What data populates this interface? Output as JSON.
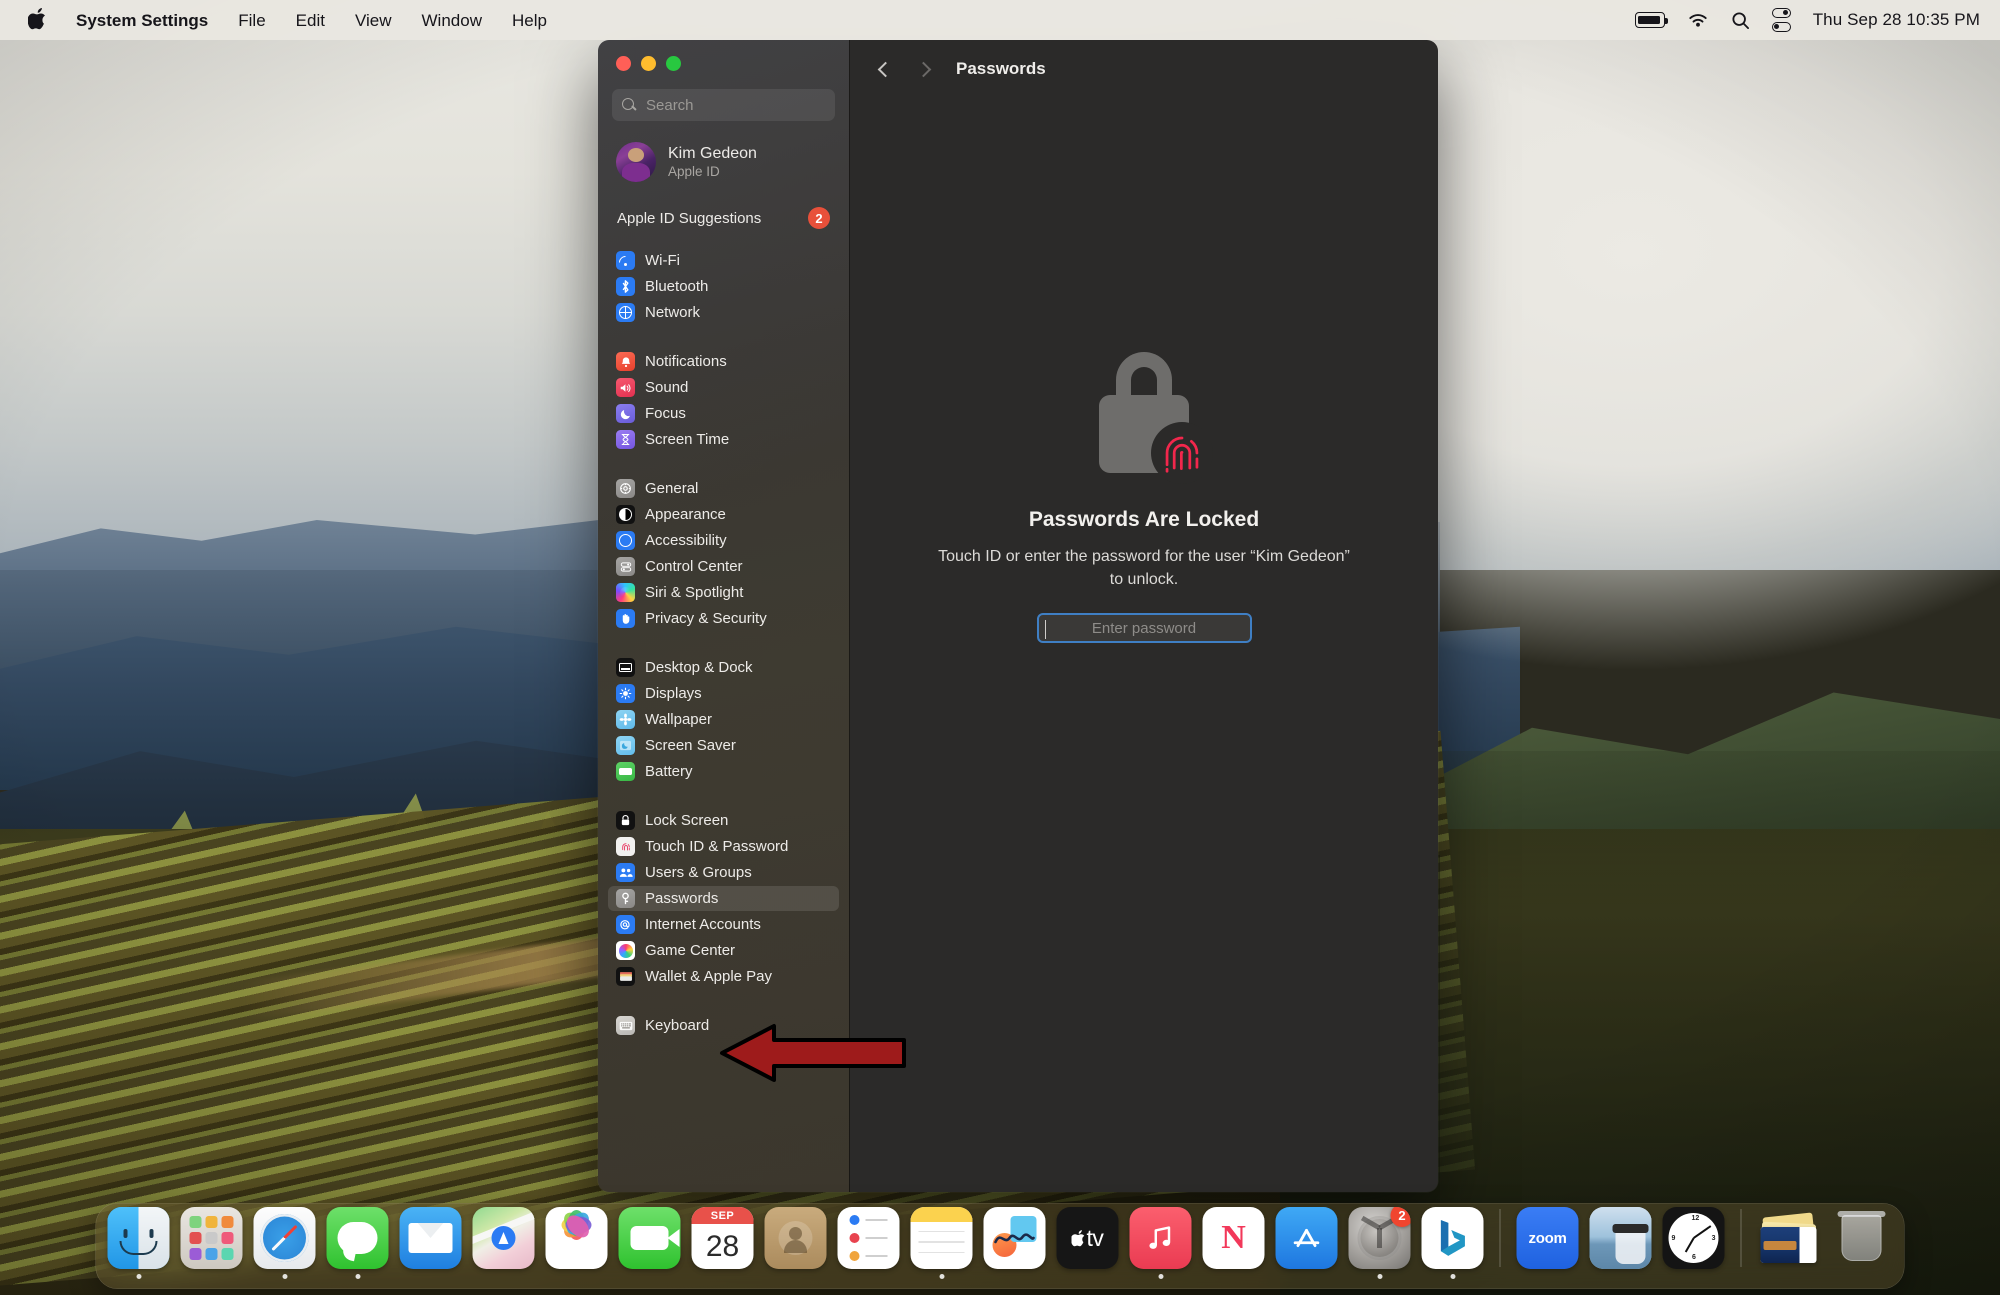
{
  "menubar": {
    "apple_logo": "apple-logo",
    "items": [
      "System Settings",
      "File",
      "Edit",
      "View",
      "Window",
      "Help"
    ],
    "status_icons": [
      "battery-icon",
      "wifi-icon",
      "search-icon",
      "control-center-icon"
    ],
    "clock": "Thu Sep 28  10:35 PM"
  },
  "window": {
    "traffic_lights": [
      "close",
      "minimize",
      "maximize"
    ],
    "search": {
      "placeholder": "Search",
      "value": ""
    },
    "account": {
      "name": "Kim Gedeon",
      "subtitle": "Apple ID"
    },
    "suggestions": {
      "label": "Apple ID Suggestions",
      "badge": "2"
    },
    "sidebar_groups": [
      {
        "items": [
          {
            "label": "Wi-Fi",
            "icon": "wifi-icon"
          },
          {
            "label": "Bluetooth",
            "icon": "bluetooth-icon"
          },
          {
            "label": "Network",
            "icon": "network-globe-icon"
          }
        ]
      },
      {
        "items": [
          {
            "label": "Notifications",
            "icon": "notifications-bell-icon"
          },
          {
            "label": "Sound",
            "icon": "sound-speaker-icon"
          },
          {
            "label": "Focus",
            "icon": "focus-moon-icon"
          },
          {
            "label": "Screen Time",
            "icon": "screen-time-hourglass-icon"
          }
        ]
      },
      {
        "items": [
          {
            "label": "General",
            "icon": "general-gear-icon"
          },
          {
            "label": "Appearance",
            "icon": "appearance-contrast-icon"
          },
          {
            "label": "Accessibility",
            "icon": "accessibility-icon"
          },
          {
            "label": "Control Center",
            "icon": "control-center-icon"
          },
          {
            "label": "Siri & Spotlight",
            "icon": "siri-icon"
          },
          {
            "label": "Privacy & Security",
            "icon": "privacy-hand-icon"
          }
        ]
      },
      {
        "items": [
          {
            "label": "Desktop & Dock",
            "icon": "desktop-dock-icon"
          },
          {
            "label": "Displays",
            "icon": "displays-brightness-icon"
          },
          {
            "label": "Wallpaper",
            "icon": "wallpaper-icon"
          },
          {
            "label": "Screen Saver",
            "icon": "screen-saver-icon"
          },
          {
            "label": "Battery",
            "icon": "battery-icon"
          }
        ]
      },
      {
        "items": [
          {
            "label": "Lock Screen",
            "icon": "lock-screen-icon"
          },
          {
            "label": "Touch ID & Password",
            "icon": "touch-id-icon"
          },
          {
            "label": "Users & Groups",
            "icon": "users-groups-icon"
          },
          {
            "label": "Passwords",
            "icon": "passwords-key-icon",
            "selected": true
          },
          {
            "label": "Internet Accounts",
            "icon": "internet-accounts-at-icon"
          },
          {
            "label": "Game Center",
            "icon": "game-center-icon"
          },
          {
            "label": "Wallet & Apple Pay",
            "icon": "wallet-icon"
          }
        ]
      },
      {
        "items": [
          {
            "label": "Keyboard",
            "icon": "keyboard-icon"
          }
        ]
      }
    ],
    "content": {
      "back_icon": "chevron-left-icon",
      "forward_icon": "chevron-right-icon",
      "title": "Passwords",
      "lock_icon": "padlock-with-fingerprint-icon",
      "heading": "Passwords Are Locked",
      "description": "Touch ID or enter the password for the user “Kim Gedeon” to unlock.",
      "password_field": {
        "placeholder": "Enter password",
        "value": ""
      }
    }
  },
  "annotation": {
    "arrow": "red-arrow-pointing-to-passwords",
    "color": "#9e1b1b"
  },
  "dock": {
    "items": [
      {
        "name": "Finder",
        "running": true
      },
      {
        "name": "Launchpad",
        "running": false
      },
      {
        "name": "Safari",
        "running": true
      },
      {
        "name": "Messages",
        "running": true
      },
      {
        "name": "Mail",
        "running": false
      },
      {
        "name": "Maps",
        "running": false
      },
      {
        "name": "Photos",
        "running": false
      },
      {
        "name": "FaceTime",
        "running": false
      },
      {
        "name": "Calendar",
        "running": false,
        "month": "SEP",
        "day": "28"
      },
      {
        "name": "Contacts",
        "running": false
      },
      {
        "name": "Reminders",
        "running": false
      },
      {
        "name": "Notes",
        "running": true
      },
      {
        "name": "Freeform",
        "running": false
      },
      {
        "name": "Apple TV",
        "running": false,
        "label": "tv"
      },
      {
        "name": "Music",
        "running": true
      },
      {
        "name": "News",
        "running": false
      },
      {
        "name": "App Store",
        "running": false
      },
      {
        "name": "System Settings",
        "running": true,
        "badge": "2"
      },
      {
        "name": "Bing",
        "running": true
      },
      {
        "name": "Zoom",
        "running": false,
        "label": "zoom"
      },
      {
        "name": "Preview",
        "running": false
      },
      {
        "name": "Clock",
        "running": false
      },
      {
        "name": "Downloads",
        "running": false
      },
      {
        "name": "Trash",
        "running": false
      }
    ]
  }
}
